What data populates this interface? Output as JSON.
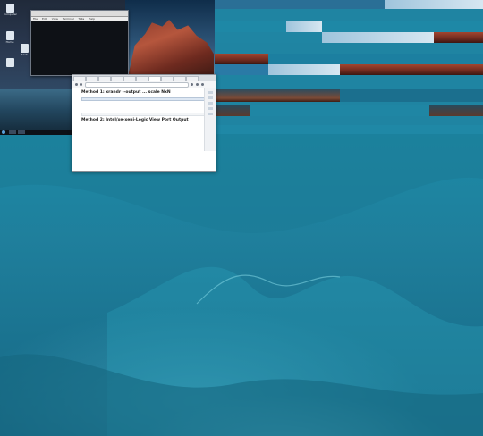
{
  "colors": {
    "desktop_teal": "#1f7f9a",
    "panel": "#0d1117",
    "terminal_bg": "#0e1116",
    "selection": "#5b9bd5"
  },
  "desktop": {
    "icons": [
      {
        "label": "Computer",
        "icon": "monitor-icon"
      },
      {
        "label": "Home",
        "icon": "folder-icon"
      },
      {
        "label": "Trash",
        "icon": "trash-icon"
      },
      {
        "label": "",
        "icon": "document-icon"
      }
    ]
  },
  "panel": {
    "clock": ""
  },
  "terminal": {
    "menu": [
      "File",
      "Edit",
      "View",
      "Terminal",
      "Tabs",
      "Help"
    ],
    "lines": [
      "",
      "",
      "",
      "",
      ""
    ]
  },
  "browser": {
    "url": "",
    "tabs": [
      "",
      "",
      "",
      "",
      "",
      "",
      "",
      "",
      "",
      ""
    ],
    "intro_text": "",
    "method1_heading": "Method 1: xrandr --output ... scale NxN",
    "method2_heading": "Method 2: Intel/xe-xeni-Logic View Port Output",
    "note_text": "",
    "code_selected": [
      "",
      ""
    ],
    "code_lines": [
      "",
      ""
    ],
    "body_lines": [
      "",
      "",
      ""
    ]
  }
}
